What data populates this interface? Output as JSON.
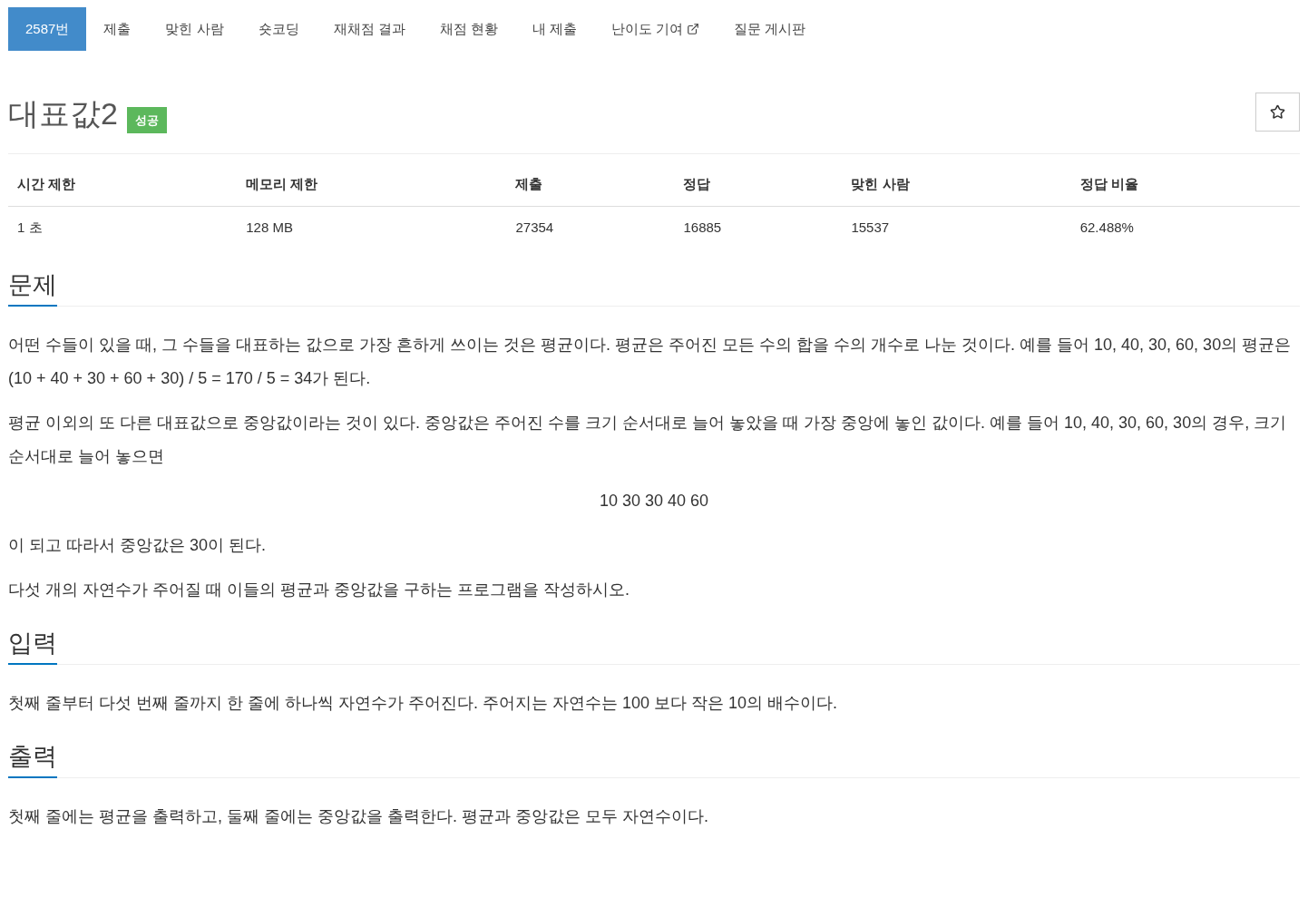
{
  "tabs": [
    {
      "label": "2587번",
      "selected": true
    },
    {
      "label": "제출",
      "selected": false
    },
    {
      "label": "맞힌 사람",
      "selected": false
    },
    {
      "label": "숏코딩",
      "selected": false
    },
    {
      "label": "재채점 결과",
      "selected": false
    },
    {
      "label": "채점 현황",
      "selected": false
    },
    {
      "label": "내 제출",
      "selected": false
    },
    {
      "label": "난이도 기여",
      "selected": false,
      "external": true
    },
    {
      "label": "질문 게시판",
      "selected": false
    }
  ],
  "problem": {
    "title": "대표값2",
    "badge": "성공",
    "starred": false
  },
  "stats": {
    "columns": [
      "시간 제한",
      "메모리 제한",
      "제출",
      "정답",
      "맞힌 사람",
      "정답 비율"
    ],
    "rows": [
      [
        "1 초",
        "128 MB",
        "27354",
        "16885",
        "15537",
        "62.488%"
      ]
    ]
  },
  "sections": [
    {
      "heading": "문제",
      "blocks": [
        {
          "kind": "paragraph",
          "text": "어떤 수들이 있을 때, 그 수들을 대표하는 값으로 가장 흔하게 쓰이는 것은 평균이다. 평균은 주어진 모든 수의 합을 수의 개수로 나눈 것이다. 예를 들어 10, 40, 30, 60, 30의 평균은 (10 + 40 + 30 + 60 + 30) / 5 = 170 / 5 = 34가 된다."
        },
        {
          "kind": "paragraph",
          "text": "평균 이외의 또 다른 대표값으로 중앙값이라는 것이 있다. 중앙값은 주어진 수를 크기 순서대로 늘어 놓았을 때 가장 중앙에 놓인 값이다. 예를 들어 10, 40, 30, 60, 30의 경우, 크기 순서대로 늘어 놓으면"
        },
        {
          "kind": "centered",
          "text": "10 30 30 40 60"
        },
        {
          "kind": "paragraph",
          "text": "이 되고 따라서 중앙값은 30이 된다."
        },
        {
          "kind": "paragraph",
          "text": "다섯 개의 자연수가 주어질 때 이들의 평균과 중앙값을 구하는 프로그램을 작성하시오."
        }
      ]
    },
    {
      "heading": "입력",
      "blocks": [
        {
          "kind": "paragraph",
          "text": "첫째 줄부터 다섯 번째 줄까지 한 줄에 하나씩 자연수가 주어진다. 주어지는 자연수는 100 보다 작은 10의 배수이다."
        }
      ]
    },
    {
      "heading": "출력",
      "blocks": [
        {
          "kind": "paragraph",
          "text": "첫째 줄에는 평균을 출력하고, 둘째 줄에는 중앙값을 출력한다. 평균과 중앙값은 모두 자연수이다."
        }
      ]
    }
  ]
}
